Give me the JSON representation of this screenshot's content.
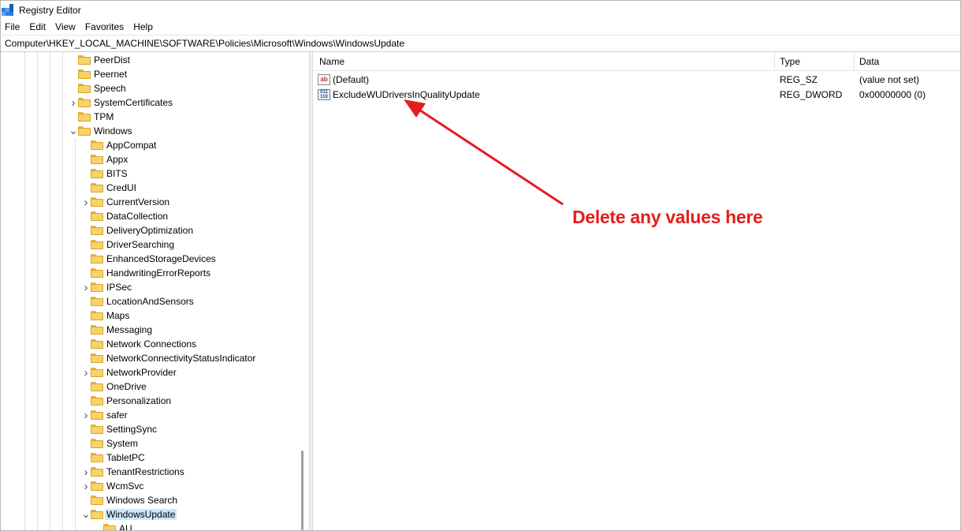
{
  "window": {
    "title": "Registry Editor"
  },
  "menu": [
    "File",
    "Edit",
    "View",
    "Favorites",
    "Help"
  ],
  "address": "Computer\\HKEY_LOCAL_MACHINE\\SOFTWARE\\Policies\\Microsoft\\Windows\\WindowsUpdate",
  "tree": {
    "items": [
      {
        "label": "PeerDist",
        "level": 1,
        "chevron": "none"
      },
      {
        "label": "Peernet",
        "level": 1,
        "chevron": "none"
      },
      {
        "label": "Speech",
        "level": 1,
        "chevron": "none"
      },
      {
        "label": "SystemCertificates",
        "level": 1,
        "chevron": "collapsed"
      },
      {
        "label": "TPM",
        "level": 1,
        "chevron": "none"
      },
      {
        "label": "Windows",
        "level": 1,
        "chevron": "expanded"
      },
      {
        "label": "AppCompat",
        "level": 2,
        "chevron": "none"
      },
      {
        "label": "Appx",
        "level": 2,
        "chevron": "none"
      },
      {
        "label": "BITS",
        "level": 2,
        "chevron": "none"
      },
      {
        "label": "CredUI",
        "level": 2,
        "chevron": "none"
      },
      {
        "label": "CurrentVersion",
        "level": 2,
        "chevron": "collapsed"
      },
      {
        "label": "DataCollection",
        "level": 2,
        "chevron": "none"
      },
      {
        "label": "DeliveryOptimization",
        "level": 2,
        "chevron": "none"
      },
      {
        "label": "DriverSearching",
        "level": 2,
        "chevron": "none"
      },
      {
        "label": "EnhancedStorageDevices",
        "level": 2,
        "chevron": "none"
      },
      {
        "label": "HandwritingErrorReports",
        "level": 2,
        "chevron": "none"
      },
      {
        "label": "IPSec",
        "level": 2,
        "chevron": "collapsed"
      },
      {
        "label": "LocationAndSensors",
        "level": 2,
        "chevron": "none"
      },
      {
        "label": "Maps",
        "level": 2,
        "chevron": "none"
      },
      {
        "label": "Messaging",
        "level": 2,
        "chevron": "none"
      },
      {
        "label": "Network Connections",
        "level": 2,
        "chevron": "none"
      },
      {
        "label": "NetworkConnectivityStatusIndicator",
        "level": 2,
        "chevron": "none"
      },
      {
        "label": "NetworkProvider",
        "level": 2,
        "chevron": "collapsed"
      },
      {
        "label": "OneDrive",
        "level": 2,
        "chevron": "none"
      },
      {
        "label": "Personalization",
        "level": 2,
        "chevron": "none"
      },
      {
        "label": "safer",
        "level": 2,
        "chevron": "collapsed"
      },
      {
        "label": "SettingSync",
        "level": 2,
        "chevron": "none"
      },
      {
        "label": "System",
        "level": 2,
        "chevron": "none"
      },
      {
        "label": "TabletPC",
        "level": 2,
        "chevron": "none"
      },
      {
        "label": "TenantRestrictions",
        "level": 2,
        "chevron": "collapsed"
      },
      {
        "label": "WcmSvc",
        "level": 2,
        "chevron": "collapsed"
      },
      {
        "label": "Windows Search",
        "level": 2,
        "chevron": "none"
      },
      {
        "label": "WindowsUpdate",
        "level": 2,
        "chevron": "expanded",
        "selected": true
      },
      {
        "label": "AU",
        "level": 3,
        "chevron": "none"
      }
    ]
  },
  "list": {
    "columns": [
      "Name",
      "Type",
      "Data"
    ],
    "rows": [
      {
        "icon": "string-value-icon",
        "name": "(Default)",
        "type": "REG_SZ",
        "data": "(value not set)"
      },
      {
        "icon": "dword-value-icon",
        "name": "ExcludeWUDriversInQualityUpdate",
        "type": "REG_DWORD",
        "data": "0x00000000 (0)"
      }
    ]
  },
  "annotation": {
    "text": "Delete any values here",
    "color": "#e41d1d"
  }
}
